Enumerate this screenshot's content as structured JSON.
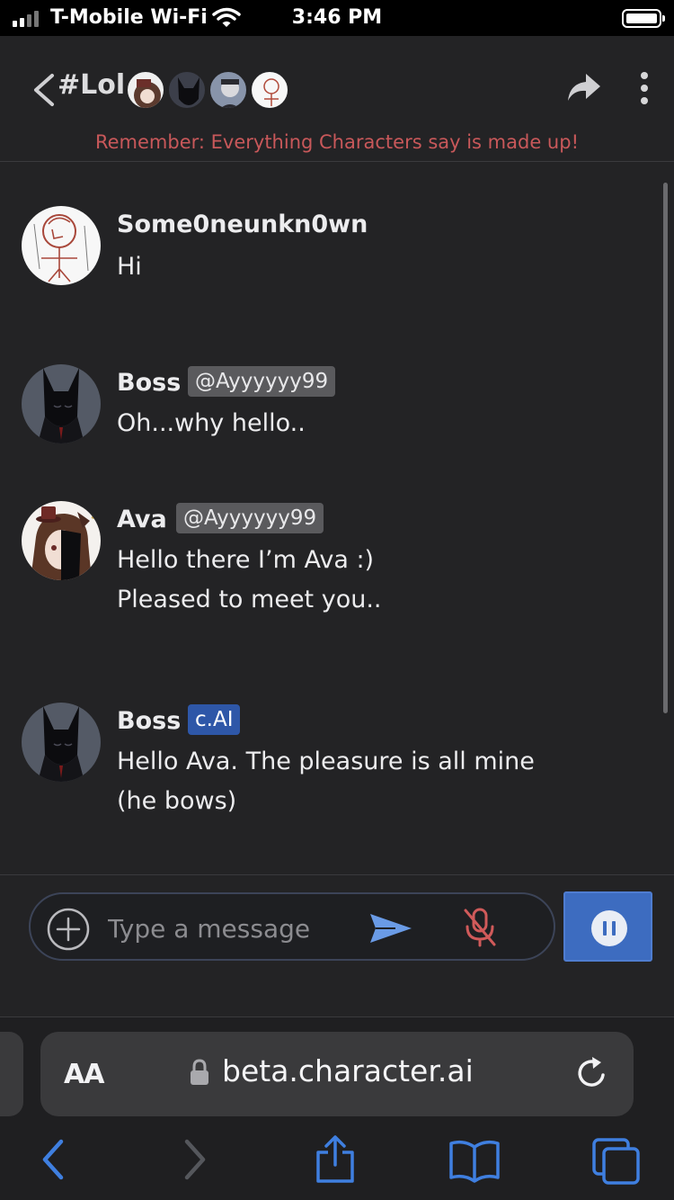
{
  "status_bar": {
    "carrier": "T-Mobile Wi-Fi",
    "time": "3:46 PM"
  },
  "header": {
    "title": "#Lol",
    "disclaimer": "Remember: Everything Characters say is made up!"
  },
  "messages": [
    {
      "name": "Some0neunkn0wn",
      "tag": "",
      "lines": [
        "Hi"
      ]
    },
    {
      "name": "Boss",
      "tag": "@Ayyyyyy99",
      "lines": [
        "Oh...why hello.."
      ]
    },
    {
      "name": "Ava",
      "tag": "@Ayyyyyy99",
      "lines": [
        "Hello there I’m Ava :)",
        "Pleased to meet you.."
      ]
    },
    {
      "name": "Boss",
      "tag": "c.AI",
      "lines": [
        "Hello Ava. The pleasure is all mine",
        "(he bows)"
      ]
    }
  ],
  "composer": {
    "placeholder": "Type a message"
  },
  "safari": {
    "text_size_label": "AA",
    "url": "beta.character.ai"
  },
  "colors": {
    "accent_blue": "#3d6cc0",
    "cai_tag": "#2e57a8",
    "disclaimer_red": "#c8585a",
    "background": "#232325"
  }
}
